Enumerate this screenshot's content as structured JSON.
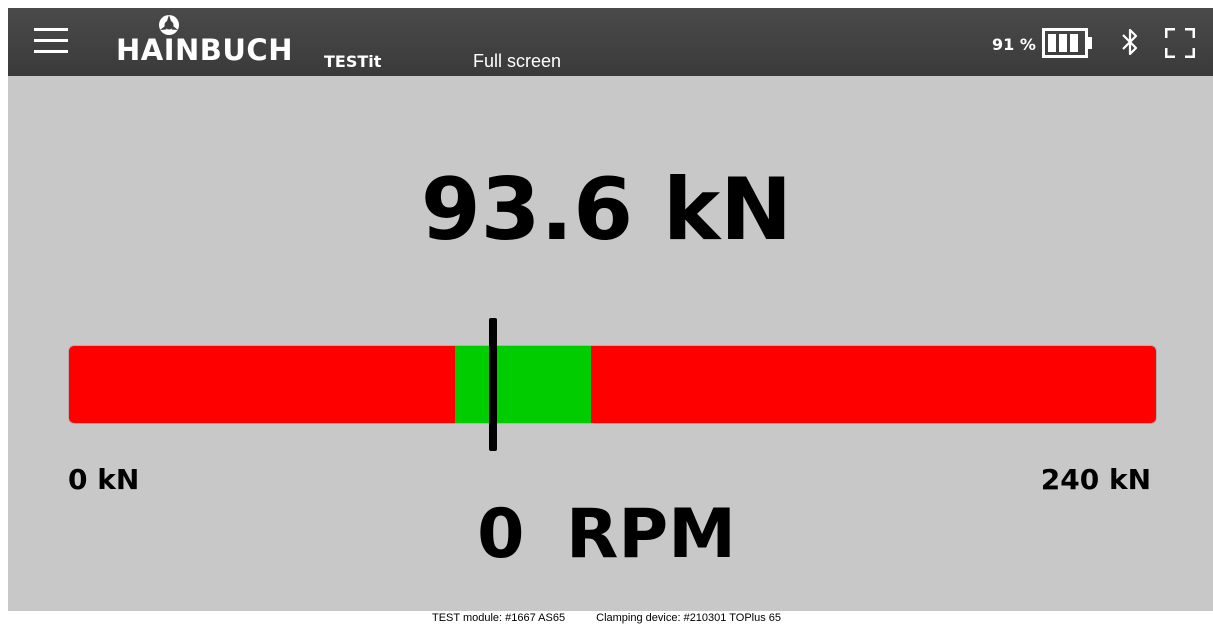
{
  "header": {
    "brand": "HAINBUCH",
    "product": "TESTit",
    "mode_label": "Full screen",
    "battery": {
      "percent_label": "91 %",
      "level_bars": 3,
      "max_bars": 4
    },
    "icons": [
      "menu-icon",
      "hainbuch-logo-icon",
      "battery-icon",
      "bluetooth-icon",
      "fullscreen-icon"
    ]
  },
  "measurement": {
    "force_label": "93.6 kN",
    "force_value": 93.6,
    "unit": "kN",
    "range_min_label": "0 kN",
    "range_max_label": "240 kN",
    "range_min": 0,
    "range_max": 240,
    "tolerance_min": 85,
    "tolerance_max": 115,
    "rpm_label": "0 RPM"
  },
  "footer": {
    "test_module": "TEST module: #1667  AS65",
    "clamping_device": "Clamping device: #210301  TOPlus 65"
  },
  "colors": {
    "header_bg": "#3f3f3f",
    "panel_bg": "#c8c8c8",
    "out_of_range": "#ff0000",
    "in_range": "#00cc00",
    "needle": "#000000"
  }
}
